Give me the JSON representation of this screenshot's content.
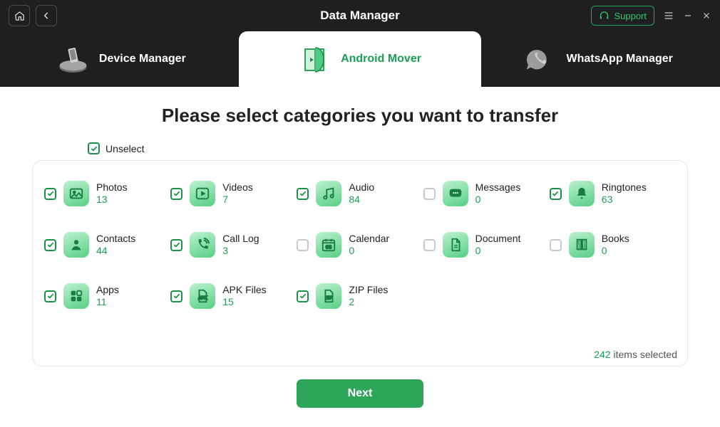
{
  "app_title": "Data Manager",
  "support_label": "Support",
  "tabs": {
    "device": "Device Manager",
    "android": "Android Mover",
    "whatsapp": "WhatsApp Manager"
  },
  "page_title": "Please select categories you want to transfer",
  "unselect_label": "Unselect",
  "categories": [
    {
      "label": "Photos",
      "count": "13",
      "checked": true,
      "glyph": "photo"
    },
    {
      "label": "Videos",
      "count": "7",
      "checked": true,
      "glyph": "play"
    },
    {
      "label": "Audio",
      "count": "84",
      "checked": true,
      "glyph": "music"
    },
    {
      "label": "Messages",
      "count": "0",
      "checked": false,
      "glyph": "chat"
    },
    {
      "label": "Ringtones",
      "count": "63",
      "checked": true,
      "glyph": "bell"
    },
    {
      "label": "Contacts",
      "count": "44",
      "checked": true,
      "glyph": "person"
    },
    {
      "label": "Call Log",
      "count": "3",
      "checked": true,
      "glyph": "phone"
    },
    {
      "label": "Calendar",
      "count": "0",
      "checked": false,
      "glyph": "cal"
    },
    {
      "label": "Document",
      "count": "0",
      "checked": false,
      "glyph": "doc"
    },
    {
      "label": "Books",
      "count": "0",
      "checked": false,
      "glyph": "book"
    },
    {
      "label": "Apps",
      "count": "11",
      "checked": true,
      "glyph": "apps"
    },
    {
      "label": "APK Files",
      "count": "15",
      "checked": true,
      "glyph": "apk"
    },
    {
      "label": "ZIP Files",
      "count": "2",
      "checked": true,
      "glyph": "zip"
    }
  ],
  "summary": {
    "selected_count": "242",
    "suffix": "items selected"
  },
  "next_label": "Next",
  "colors": {
    "accent": "#1e9e55",
    "accent_btn": "#2ea65a"
  }
}
